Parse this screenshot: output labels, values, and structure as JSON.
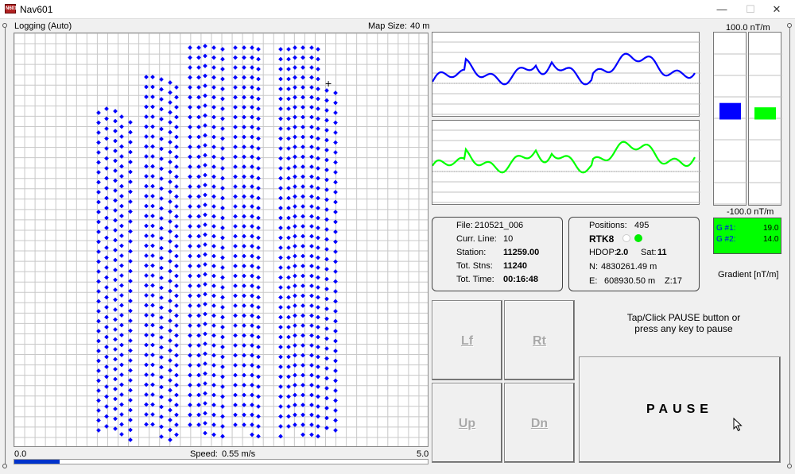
{
  "window": {
    "title": "Nav601",
    "app_icon_text": "N601",
    "minimize_glyph": "—",
    "maximize_glyph": "☐",
    "close_glyph": "✕"
  },
  "map": {
    "status": "Logging (Auto)",
    "size_label": "Map Size:",
    "size_value": "40 m",
    "cursor_glyph": "+"
  },
  "speed": {
    "min": "0.0",
    "max": "5.0",
    "label": "Speed:",
    "value": "0.55 m/s",
    "fraction": 0.11
  },
  "gradient_scale": {
    "top": "100.0 nT/m",
    "bottom": "-100.0 nT/m",
    "unit_label": "Gradient [nT/m]",
    "g1_label": "G #1:",
    "g1_value": "19.0",
    "g2_label": "G #2:",
    "g2_value": "14.0",
    "g1_color": "#0000ff",
    "g2_color": "#00ff00"
  },
  "file_info": {
    "file_label": "File:",
    "file_value": "210521_006",
    "line_label": "Curr. Line:",
    "line_value": "10",
    "station_label": "Station:",
    "station_value": "11259.00",
    "stns_label": "Tot. Stns:",
    "stns_value": "11240",
    "time_label": "Tot. Time:",
    "time_value": "00:16:48"
  },
  "gps_info": {
    "positions_label": "Positions:",
    "positions_value": "495",
    "rtk_label": "RTK8",
    "hdop_label": "HDOP:",
    "hdop_value": "2.0",
    "sat_label": "Sat:",
    "sat_value": "11",
    "north_label": "N:",
    "north_value": "4830261.49 m",
    "east_label": "E:",
    "east_value": "608930.50 m",
    "zone_value": "Z:17",
    "indicator_colors": [
      "#ffffff",
      "#00ee00"
    ]
  },
  "controls": {
    "left": "Lf",
    "right": "Rt",
    "up": "Up",
    "down": "Dn",
    "pause": "PAUSE",
    "hint_line1": "Tap/Click PAUSE button or",
    "hint_line2": "press any key to pause"
  }
}
